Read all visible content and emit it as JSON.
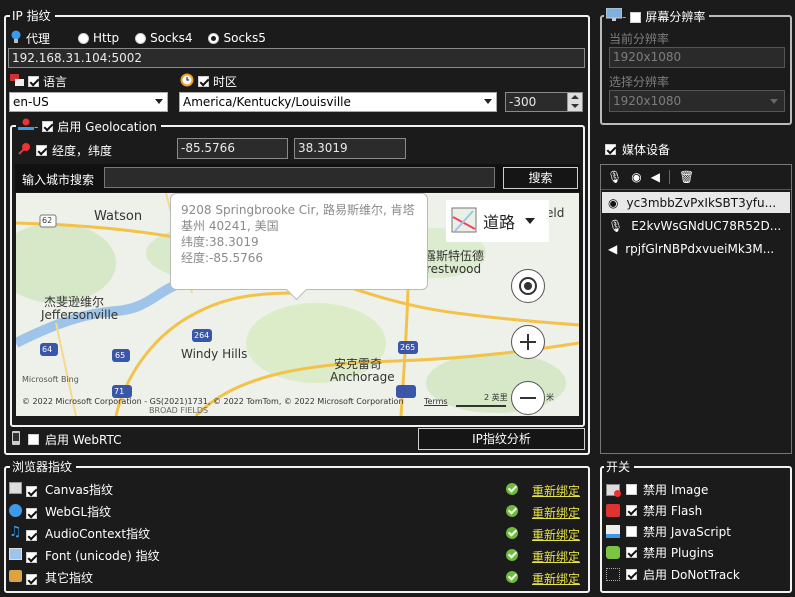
{
  "ip_group": {
    "title": "IP 指纹",
    "proxy_label": "代理",
    "proxy_options": [
      "Http",
      "Socks4",
      "Socks5"
    ],
    "proxy_selected": "Socks5",
    "proxy_value": "192.168.31.104:5002"
  },
  "language": {
    "label": "语言",
    "value": "en-US"
  },
  "timezone": {
    "label": "时区",
    "value": "America/Kentucky/Louisville",
    "offset": "-300"
  },
  "geolocation": {
    "title": "启用 Geolocation",
    "coords_label": "经度，纬度",
    "longitude": "-85.5766",
    "latitude": "38.3019",
    "search_label": "输入城市搜索",
    "search_value": "",
    "search_button": "搜索"
  },
  "map": {
    "places": [
      "Watson",
      "杰斐逊维尔",
      "Jeffersonville",
      "Windy Hills",
      "安克雷奇",
      "Anchorage",
      "露斯特伍德",
      "restwood",
      "eld",
      "BROAD FIELDS"
    ],
    "roads": [
      "62",
      "64",
      "65",
      "71",
      "265",
      "264"
    ],
    "popup_address": "9208 Springbrooke Cir, 路易斯维尔, 肯塔基州 40241, 美国",
    "popup_lat": "纬度:38.3019",
    "popup_lng": "经度:-85.5766",
    "map_type": "道路",
    "copyright": "© 2022 Microsoft Corporation - GS(2021)1731, © 2022 TomTom, © 2022 Microsoft Corporation",
    "terms": "Terms",
    "scale": "2 英里",
    "scale_end": "米",
    "brand": "Microsoft Bing"
  },
  "webrtc": {
    "label": "启用 WebRTC"
  },
  "ip_analyze_button": "IP指纹分析",
  "screen": {
    "title": "屏幕分辨率",
    "current_label": "当前分辨率",
    "current_value": "1920x1080",
    "select_label": "选择分辨率",
    "select_value": "1920x1080"
  },
  "media": {
    "title": "媒体设备",
    "devices": [
      "yc3mbbZvPxIkSBT3yfu...",
      "E2kvWsGNdUC78R52D...",
      "rpjfGlrNBPdxvueiMk3M..."
    ]
  },
  "browser_fp": {
    "title": "浏览器指纹",
    "rebind": "重新绑定",
    "items": [
      "Canvas指纹",
      "WebGL指纹",
      "AudioContext指纹",
      "Font (unicode) 指纹",
      "其它指纹"
    ]
  },
  "switches": {
    "title": "开关",
    "items": [
      "禁用 Image",
      "禁用 Flash",
      "禁用 JavaScript",
      "禁用 Plugins",
      "启用 DoNotTrack"
    ],
    "checked": [
      false,
      true,
      false,
      true,
      true
    ]
  }
}
